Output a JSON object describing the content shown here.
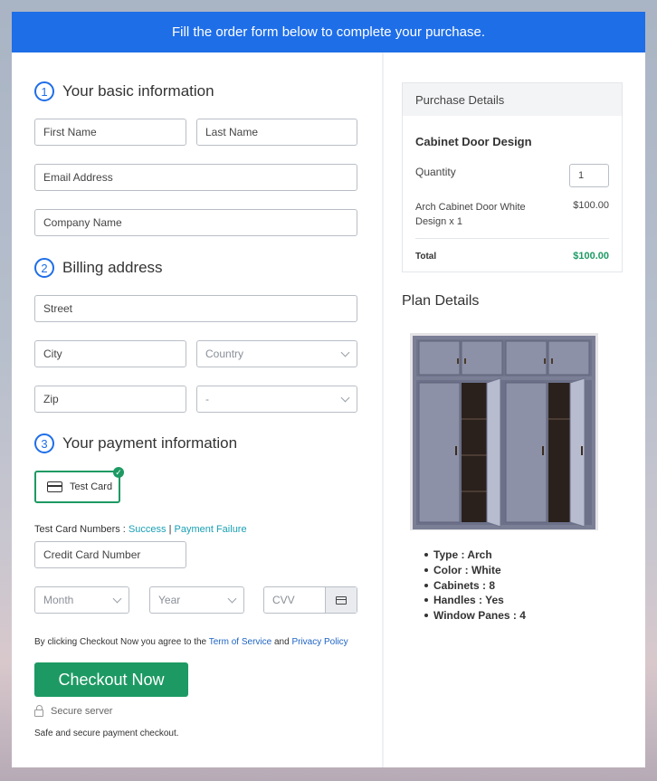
{
  "banner": "Fill the order form below to complete your purchase.",
  "basic": {
    "step": "1",
    "title": "Your basic information",
    "first_name": "First Name",
    "last_name": "Last Name",
    "email": "Email Address",
    "company": "Company Name"
  },
  "billing": {
    "step": "2",
    "title": "Billing address",
    "street": "Street",
    "city": "City",
    "country": "Country",
    "zip": "Zip",
    "state": "-"
  },
  "payment": {
    "step": "3",
    "title": "Your payment information",
    "test_card": "Test Card",
    "test_card_numbers_label": "Test Card Numbers :",
    "success_link": "Success",
    "separator": "|",
    "failure_link": "Payment Failure",
    "card_number": "Credit Card Number",
    "month": "Month",
    "year": "Year",
    "cvv": "CVV",
    "agree_text": "By clicking Checkout Now you agree to the",
    "terms_link": "Term of Service",
    "and_text": "and",
    "privacy_link": "Privacy Policy",
    "checkout_button": "Checkout Now",
    "secure_server": "Secure server",
    "safe_text": "Safe and secure payment checkout."
  },
  "purchase": {
    "header": "Purchase Details",
    "product": "Cabinet Door Design",
    "quantity_label": "Quantity",
    "quantity_value": "1",
    "item_line1": "Arch Cabinet Door White",
    "item_line2": "Design x 1",
    "item_price": "$100.00",
    "total_label": "Total",
    "total_value": "$100.00"
  },
  "plan": {
    "title": "Plan Details",
    "features": [
      "Type : Arch",
      "Color : White",
      "Cabinets : 8",
      "Handles : Yes",
      "Window Panes : 4"
    ]
  },
  "colors": {
    "accent": "#1e6ee8",
    "success": "#1d9a63",
    "link": "#1aa0b4"
  }
}
